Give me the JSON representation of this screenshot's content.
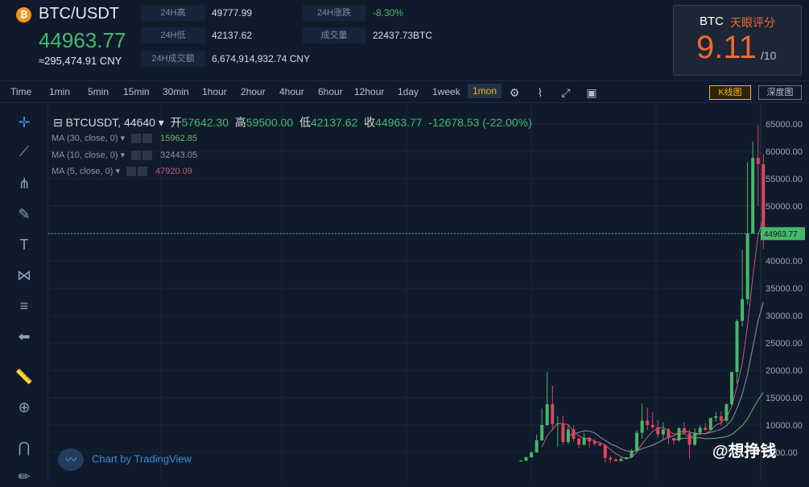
{
  "header": {
    "pair": "BTC/USDT",
    "price": "44963.77",
    "cny": "≈295,474.91 CNY",
    "stats": [
      {
        "label": "24H高",
        "value": "49777.99"
      },
      {
        "label": "24H低",
        "value": "42137.62"
      },
      {
        "label": "24H成交额",
        "value": "6,674,914,932.74 CNY"
      },
      {
        "label": "24H涨跌",
        "value": "-8.30%"
      },
      {
        "label": "成交量",
        "value": "22437.73BTC"
      }
    ]
  },
  "score": {
    "coin": "BTC",
    "title": "天眼评分",
    "value": "9.11",
    "denom": "/10"
  },
  "toolbar": {
    "intervals": [
      "Time",
      "1min",
      "5min",
      "15min",
      "30min",
      "1hour",
      "2hour",
      "4hour",
      "6hour",
      "12hour",
      "1day",
      "1week",
      "1mon"
    ],
    "active": "1mon",
    "kline_label": "K线图",
    "depth_label": "深度图"
  },
  "legend": {
    "symbol": "BTCUSDT, 44640",
    "open_label": "开",
    "open": "57642.30",
    "high_label": "高",
    "high": "59500.00",
    "low_label": "低",
    "low": "42137.62",
    "close_label": "收",
    "close": "44963.77",
    "change": "-12678.53 (-22.00%)"
  },
  "ma": [
    {
      "label": "MA (30, close, 0)",
      "value": "15962.85",
      "color": "#6fb36f"
    },
    {
      "label": "MA (10, close, 0)",
      "value": "32443.05",
      "color": "#8b95a6"
    },
    {
      "label": "MA (5, close, 0)",
      "value": "47920.09",
      "color": "#c45b77"
    }
  ],
  "branding": {
    "tradingview": "Chart by TradingView",
    "watermark": "@想挣钱"
  },
  "colors": {
    "up": "#46b86a",
    "down": "#e0455c",
    "bg": "#0f1a2b"
  },
  "chart_data": {
    "type": "candlestick",
    "y_ticks": [
      65000,
      60000,
      55000,
      50000,
      45000,
      40000,
      35000,
      30000,
      25000,
      20000,
      15000,
      10000,
      5000
    ],
    "ylim": [
      0,
      66000
    ],
    "last_price": "44963.77",
    "grid": true
  }
}
